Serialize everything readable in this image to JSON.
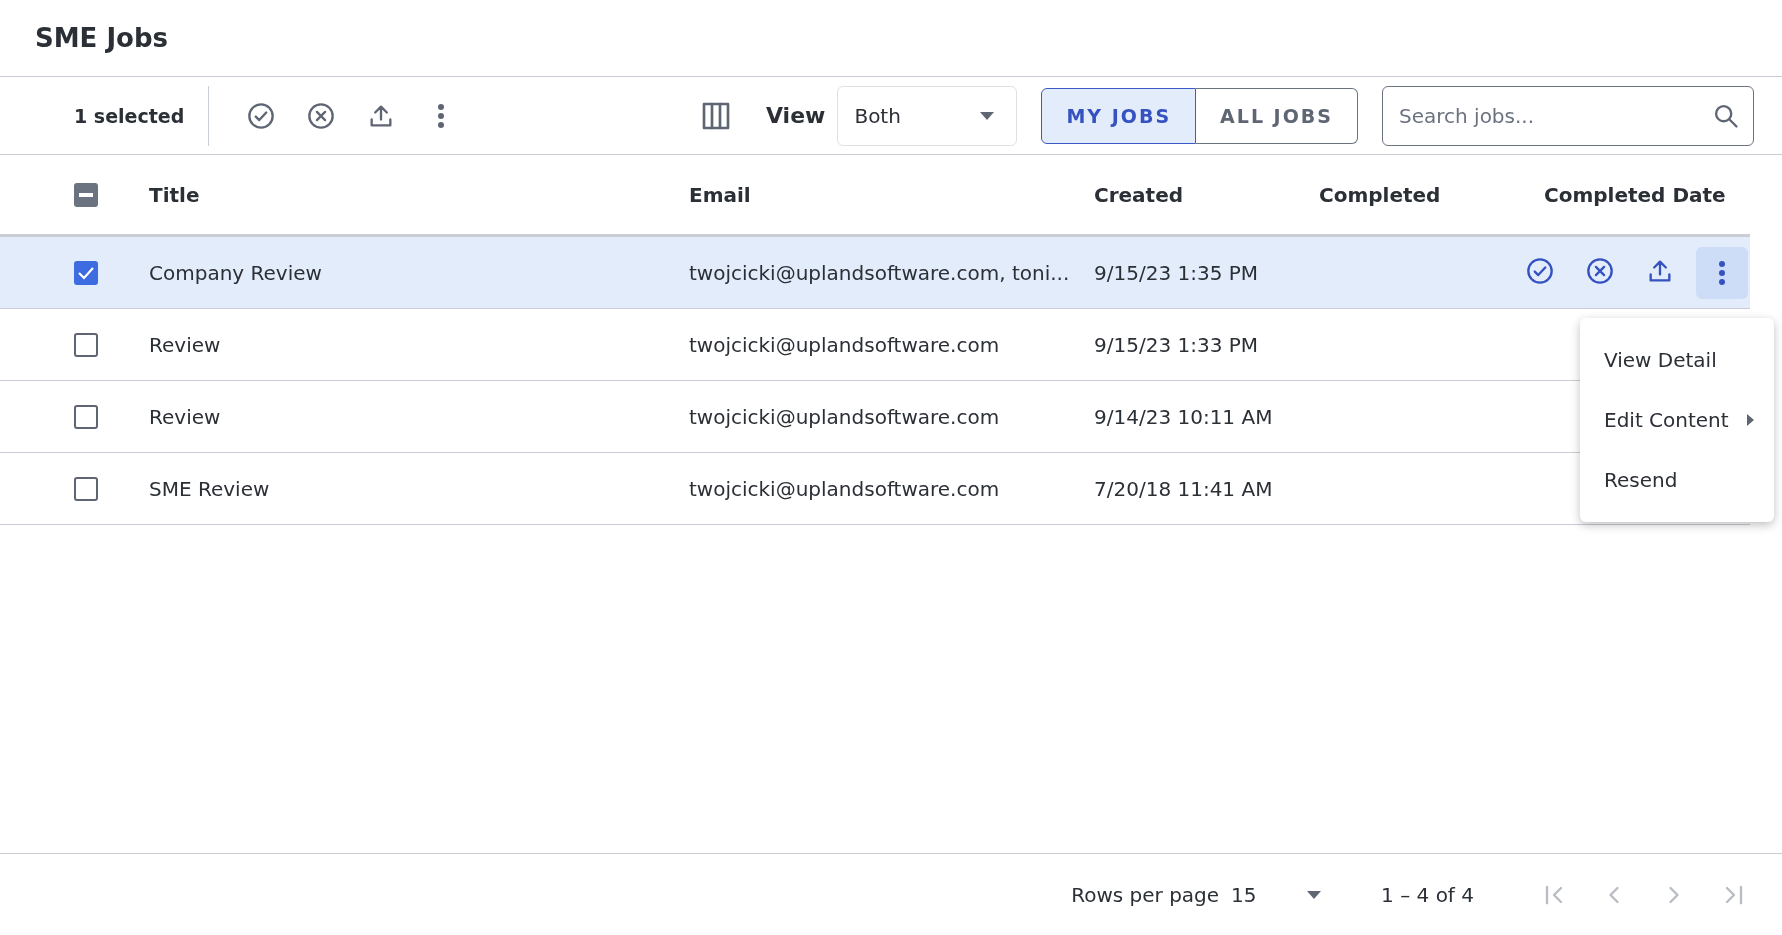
{
  "header": {
    "title": "SME Jobs"
  },
  "toolbar": {
    "selection_count": "1 selected",
    "view_label": "View",
    "view_value": "Both",
    "toggle": [
      {
        "label": "MY JOBS",
        "selected": true
      },
      {
        "label": "ALL JOBS",
        "selected": false
      }
    ],
    "search": {
      "placeholder": "Search jobs..."
    }
  },
  "table": {
    "all_checkbox": {
      "indeterminate": true
    },
    "columns": [
      "Title",
      "Email",
      "Created",
      "Completed",
      "Completed Date"
    ],
    "rows": [
      {
        "selected": true,
        "title": "Company Review",
        "email": "twojcicki@uplandsoftware.com, toni...",
        "created": "9/15/23 1:35 PM"
      },
      {
        "selected": false,
        "title": "Review",
        "email": "twojcicki@uplandsoftware.com",
        "created": "9/15/23 1:33 PM"
      },
      {
        "selected": false,
        "title": "Review",
        "email": "twojcicki@uplandsoftware.com",
        "created": "9/14/23 10:11 AM"
      },
      {
        "selected": false,
        "title": "SME Review",
        "email": "twojcicki@uplandsoftware.com",
        "created": "7/20/18 11:41 AM"
      }
    ]
  },
  "context_menu": {
    "items": [
      {
        "label": "View Detail",
        "submenu": false
      },
      {
        "label": "Edit Content",
        "submenu": true
      },
      {
        "label": "Resend",
        "submenu": false
      }
    ]
  },
  "footer": {
    "rows_per_page_label": "Rows per page",
    "rows_per_page": "15",
    "range": "1 – 4 of 4",
    "nav": [
      {
        "kind": "first",
        "disabled": true
      },
      {
        "kind": "prev",
        "disabled": true
      },
      {
        "kind": "next",
        "disabled": true
      },
      {
        "kind": "last",
        "disabled": true
      }
    ]
  }
}
